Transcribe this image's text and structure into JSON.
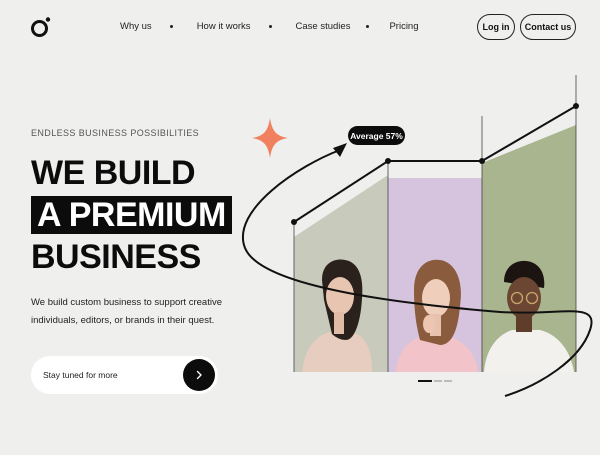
{
  "nav": {
    "links": [
      "Why us",
      "How it works",
      "Case studies",
      "Pricing"
    ],
    "login": "Log in",
    "contact": "Contact us"
  },
  "hero": {
    "eyebrow": "ENDLESS BUSINESS POSSIBILITIES",
    "line1": "WE BUILD",
    "line2": "A PREMIUM",
    "line3": "BUSINESS",
    "description": "We build custom business to support creative individuals, editors, or brands in their quest.",
    "subscribe_placeholder": "Stay tuned for more"
  },
  "graphic": {
    "badge": "Average 57%"
  },
  "colors": {
    "background": "#efefed",
    "panel_sage": "#c8cabb",
    "panel_lilac": "#d6c3dd",
    "panel_olive": "#a8b58e",
    "star": "#f08060"
  },
  "icons": [
    "logo-icon",
    "star-icon",
    "arrow-right-icon"
  ]
}
